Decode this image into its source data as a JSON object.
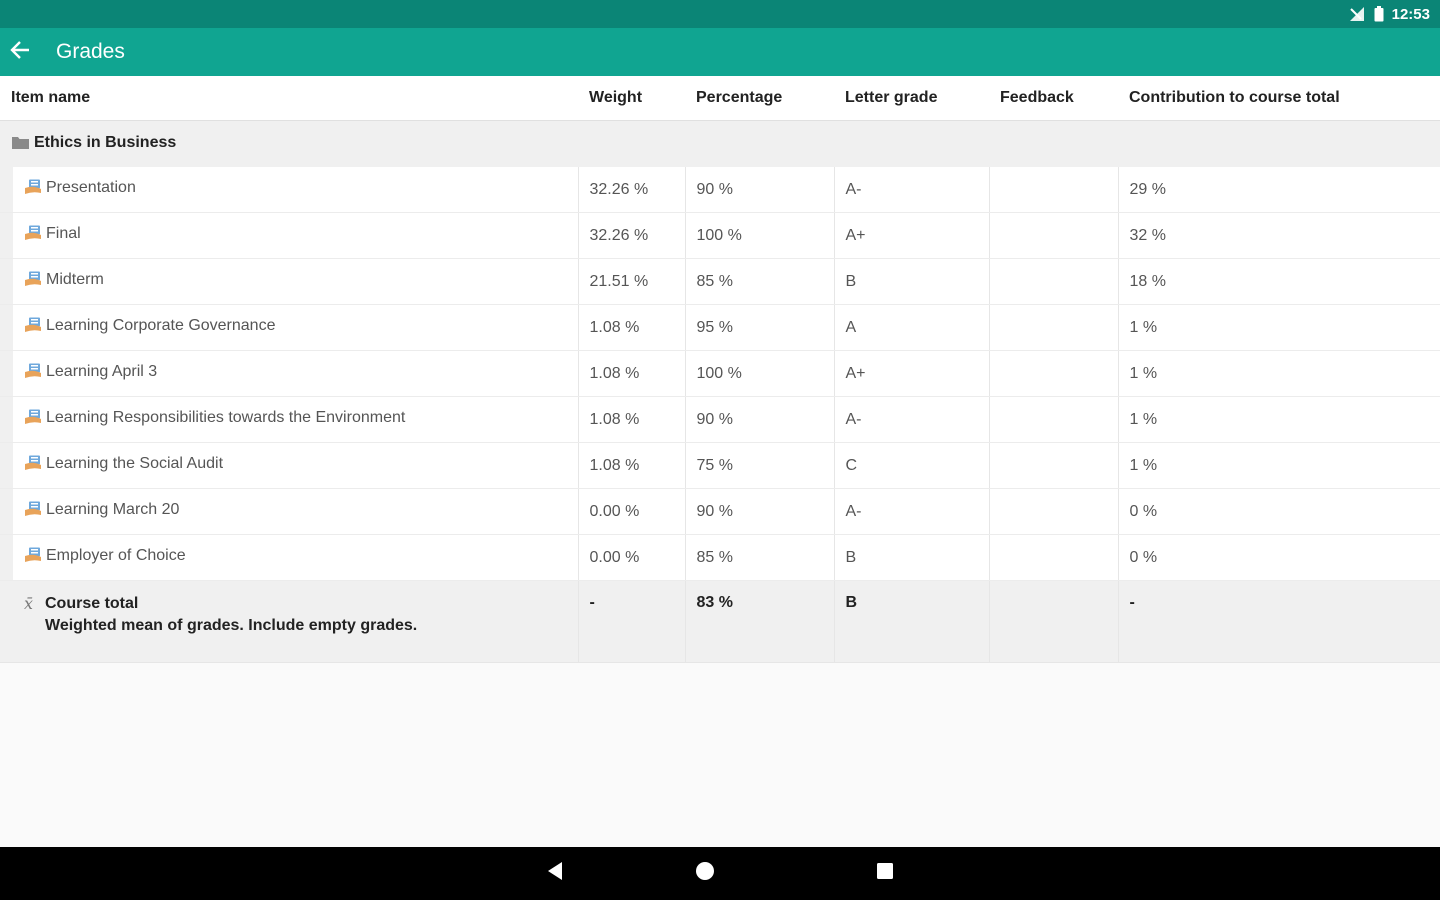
{
  "status_bar": {
    "time": "12:53"
  },
  "app_bar": {
    "title": "Grades",
    "back_icon": "arrow-left-icon"
  },
  "table": {
    "columns": [
      "Item name",
      "Weight",
      "Percentage",
      "Letter grade",
      "Feedback",
      "Contribution to course total"
    ],
    "category": "Ethics in Business",
    "rows": [
      {
        "name": "Presentation",
        "weight": "32.26 %",
        "percentage": "90 %",
        "letter": "A-",
        "feedback": "",
        "contribution": "29 %"
      },
      {
        "name": "Final",
        "weight": "32.26 %",
        "percentage": "100 %",
        "letter": "A+",
        "feedback": "",
        "contribution": "32 %"
      },
      {
        "name": "Midterm",
        "weight": "21.51 %",
        "percentage": "85 %",
        "letter": "B",
        "feedback": "",
        "contribution": "18 %"
      },
      {
        "name": "Learning Corporate Governance",
        "weight": "1.08 %",
        "percentage": "95 %",
        "letter": "A",
        "feedback": "",
        "contribution": "1 %"
      },
      {
        "name": "Learning April 3",
        "weight": "1.08 %",
        "percentage": "100 %",
        "letter": "A+",
        "feedback": "",
        "contribution": "1 %"
      },
      {
        "name": "Learning Responsibilities towards the Environment",
        "weight": "1.08 %",
        "percentage": "90 %",
        "letter": "A-",
        "feedback": "",
        "contribution": "1 %"
      },
      {
        "name": "Learning the Social Audit",
        "weight": "1.08 %",
        "percentage": "75 %",
        "letter": "C",
        "feedback": "",
        "contribution": "1 %"
      },
      {
        "name": "Learning March 20",
        "weight": "0.00 %",
        "percentage": "90 %",
        "letter": "A-",
        "feedback": "",
        "contribution": "0 %"
      },
      {
        "name": "Employer of Choice",
        "weight": "0.00 %",
        "percentage": "85 %",
        "letter": "B",
        "feedback": "",
        "contribution": "0 %"
      }
    ],
    "total": {
      "name": "Course total",
      "description": "Weighted mean of grades. Include empty grades.",
      "weight": "-",
      "percentage": "83 %",
      "letter": "B",
      "feedback": "",
      "contribution": "-"
    }
  },
  "icons": {
    "item": "assignment-icon",
    "category": "folder-icon",
    "total": "sigma-icon"
  },
  "colors": {
    "status_bar": "#0b8576",
    "app_bar": "#10a591",
    "nav_bar": "#000000"
  }
}
